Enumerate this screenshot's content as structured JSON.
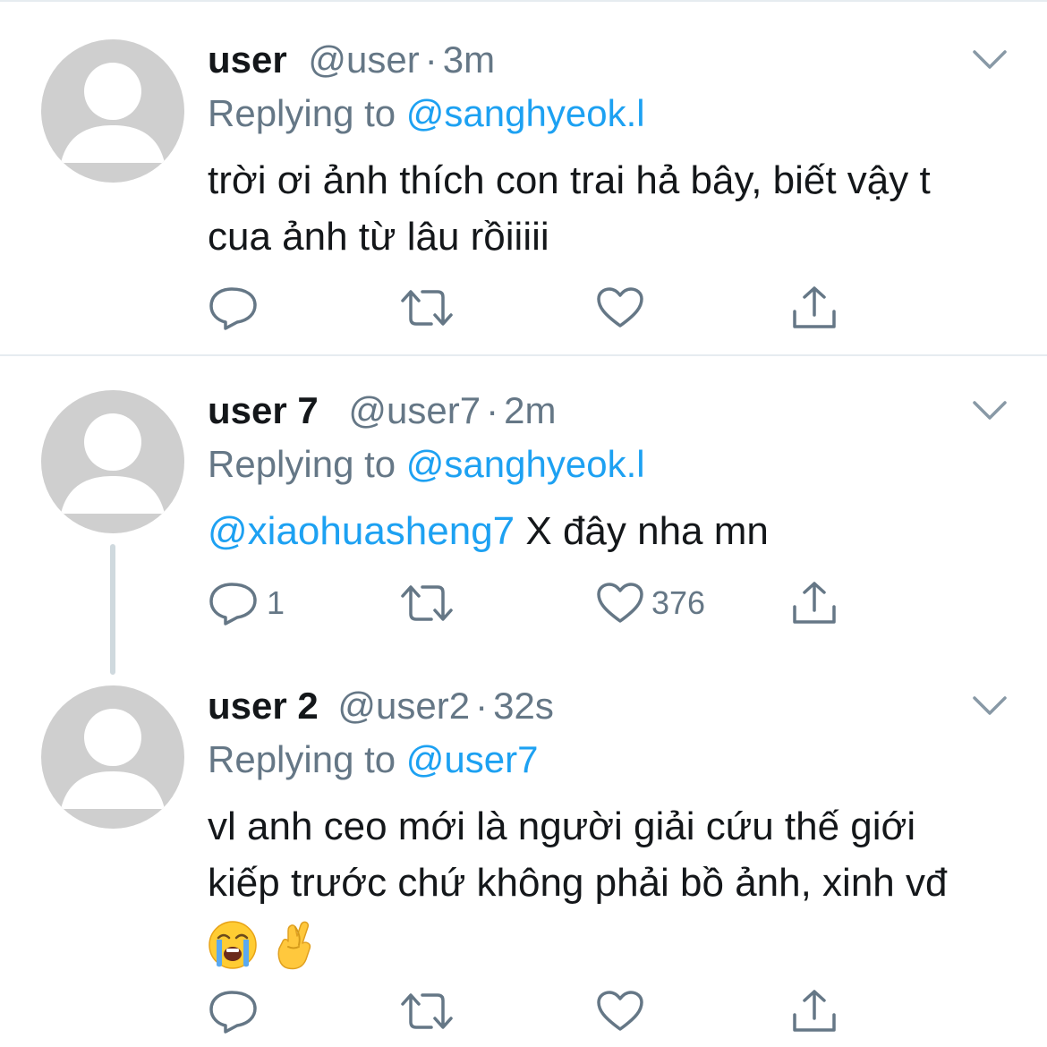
{
  "tweets": [
    {
      "name": "user",
      "handle": "@user",
      "time": "3m",
      "replying_label": "Replying to",
      "replying_handle": "@sanghyeok.l",
      "text_line1": "trời ơi ảnh thích con trai hả bây, biết vậy t",
      "text_line2": "cua ảnh từ lâu rồiiiii",
      "reply_count": "",
      "like_count": ""
    },
    {
      "name": "user 7",
      "handle": "@user7",
      "time": "2m",
      "replying_label": "Replying to",
      "replying_handle": "@sanghyeok.l",
      "mention": "@xiaohuasheng7",
      "text_line1": " X đây nha mn",
      "reply_count": "1",
      "like_count": "376"
    },
    {
      "name": "user 2",
      "handle": "@user2",
      "time": "32s",
      "replying_label": "Replying to",
      "replying_handle": "@user7",
      "text_line1": "vl anh ceo mới là người giải cứu thế giới",
      "text_line2": "kiếp trước chứ không phải bồ ảnh, xinh vđ",
      "emojis": [
        "loudly-crying-face",
        "crossed-fingers"
      ],
      "reply_count": "",
      "like_count": ""
    }
  ],
  "separator": "·",
  "colors": {
    "link": "#1da1f2",
    "secondary": "#657786",
    "primary": "#14171a",
    "divider": "#e6ecf0",
    "avatar": "#cfcfcf"
  },
  "icons": [
    "reply-icon",
    "retweet-icon",
    "like-icon",
    "share-icon",
    "chevron-down-icon",
    "default-avatar-icon"
  ]
}
